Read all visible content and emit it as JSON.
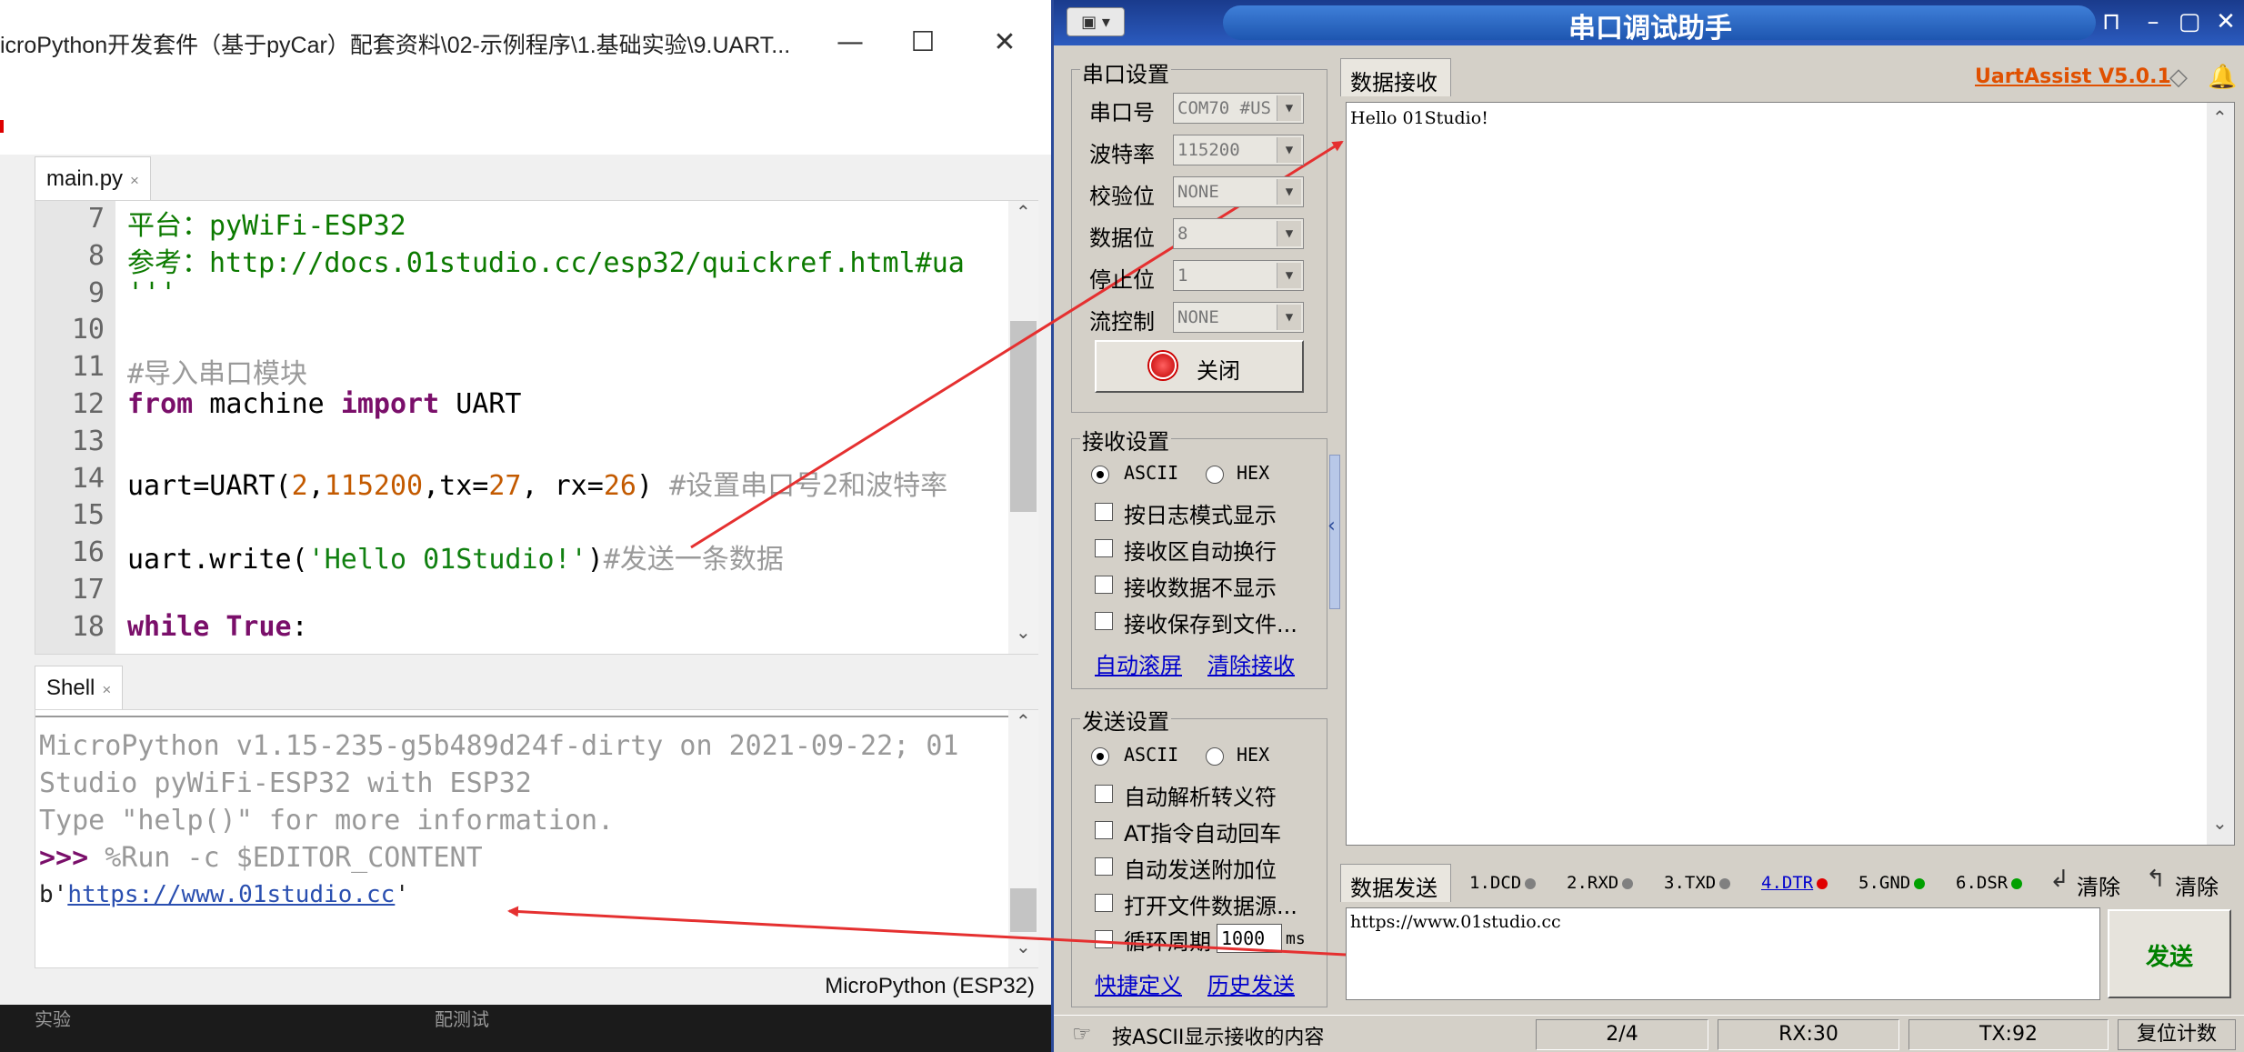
{
  "thonny": {
    "title": "icroPython开发套件（基于pyCar）配套资料\\02-示例程序\\1.基础实验\\9.UART...",
    "editor_tab": "main.py",
    "shell_tab": "Shell",
    "tab_close": "×",
    "code_lines": [
      {
        "n": "7",
        "parts": [
          {
            "c": "doc",
            "t": "平台：pyWiFi-ESP32"
          }
        ]
      },
      {
        "n": "8",
        "parts": [
          {
            "c": "doc",
            "t": "参考：http://docs.01studio.cc/esp32/quickref.html#ua"
          }
        ]
      },
      {
        "n": "9",
        "parts": [
          {
            "c": "doc",
            "t": "'''"
          }
        ]
      },
      {
        "n": "10",
        "parts": []
      },
      {
        "n": "11",
        "parts": [
          {
            "c": "cmt",
            "t": "#导入串口模块"
          }
        ]
      },
      {
        "n": "12",
        "parts": [
          {
            "c": "kw",
            "t": "from"
          },
          {
            "c": "",
            "t": " machine "
          },
          {
            "c": "kw",
            "t": "import"
          },
          {
            "c": "",
            "t": " UART"
          }
        ]
      },
      {
        "n": "13",
        "parts": []
      },
      {
        "n": "14",
        "parts": [
          {
            "c": "",
            "t": "uart=UART("
          },
          {
            "c": "num",
            "t": "2"
          },
          {
            "c": "",
            "t": ","
          },
          {
            "c": "num",
            "t": "115200"
          },
          {
            "c": "",
            "t": ",tx="
          },
          {
            "c": "num",
            "t": "27"
          },
          {
            "c": "",
            "t": ", rx="
          },
          {
            "c": "num",
            "t": "26"
          },
          {
            "c": "",
            "t": ") "
          },
          {
            "c": "cmt",
            "t": "#设置串口号2和波特率"
          }
        ]
      },
      {
        "n": "15",
        "parts": []
      },
      {
        "n": "16",
        "parts": [
          {
            "c": "",
            "t": "uart.write("
          },
          {
            "c": "str",
            "t": "'Hello 01Studio!'"
          },
          {
            "c": "",
            "t": ")"
          },
          {
            "c": "cmt",
            "t": "#发送一条数据"
          }
        ]
      },
      {
        "n": "17",
        "parts": []
      },
      {
        "n": "18",
        "parts": [
          {
            "c": "kw",
            "t": "while"
          },
          {
            "c": "",
            "t": " "
          },
          {
            "c": "kw",
            "t": "True"
          },
          {
            "c": "",
            "t": ":"
          }
        ]
      }
    ],
    "shell_lines": [
      "MicroPython v1.15-235-g5b489d24f-dirty on 2021-09-22; 01",
      "Studio pyWiFi-ESP32 with ESP32",
      "Type \"help()\" for more information."
    ],
    "shell_prompt": ">>>",
    "shell_command": " %Run -c $EDITOR_CONTENT",
    "output_prefix": " b'",
    "output_link": "https://www.01studio.cc",
    "output_suffix": "'",
    "status_text": "MicroPython (ESP32)",
    "taskbar_left": "实验",
    "taskbar_mid": "配测试"
  },
  "uart": {
    "title": "串口调试助手",
    "brand": "UartAssist V5.0.1",
    "port_group": "串口设置",
    "fields": [
      {
        "label": "串口号",
        "value": "COM70 #US"
      },
      {
        "label": "波特率",
        "value": "115200"
      },
      {
        "label": "校验位",
        "value": "NONE"
      },
      {
        "label": "数据位",
        "value": "8"
      },
      {
        "label": "停止位",
        "value": "1"
      },
      {
        "label": "流控制",
        "value": "NONE"
      }
    ],
    "close_button": "关闭",
    "recv_group": "接收设置",
    "recv_ascii": "ASCII",
    "recv_hex": "HEX",
    "recv_options": [
      "按日志模式显示",
      "接收区自动换行",
      "接收数据不显示",
      "接收保存到文件..."
    ],
    "auto_scroll": "自动滚屏",
    "clear_recv": "清除接收",
    "send_group": "发送设置",
    "send_ascii": "ASCII",
    "send_hex": "HEX",
    "send_options": [
      "自动解析转义符",
      "AT指令自动回车",
      "自动发送附加位",
      "打开文件数据源..."
    ],
    "loop_label": "循环周期",
    "loop_value": "1000",
    "loop_unit": "ms",
    "shortcut": "快捷定义",
    "history": "历史发送",
    "recv_tab": "数据接收",
    "recv_text": "Hello 01Studio!",
    "send_tab": "数据发送",
    "signals": [
      {
        "label": "1.DCD",
        "color": "#808080",
        "link": false
      },
      {
        "label": "2.RXD",
        "color": "#808080",
        "link": false
      },
      {
        "label": "3.TXD",
        "color": "#808080",
        "link": false
      },
      {
        "label": "4.DTR",
        "color": "#e00000",
        "link": true
      },
      {
        "label": "5.GND",
        "color": "#00a000",
        "link": false
      },
      {
        "label": "6.DSR",
        "color": "#00a000",
        "link": false
      }
    ],
    "clear1": "清除",
    "clear2": "清除",
    "send_text": "https://www.01studio.cc",
    "send_button": "发送",
    "status_msg": "按ASCII显示接收的内容",
    "status_pages": "2/4",
    "status_rx": "RX:30",
    "status_tx": "TX:92",
    "reset_count": "复位计数"
  }
}
